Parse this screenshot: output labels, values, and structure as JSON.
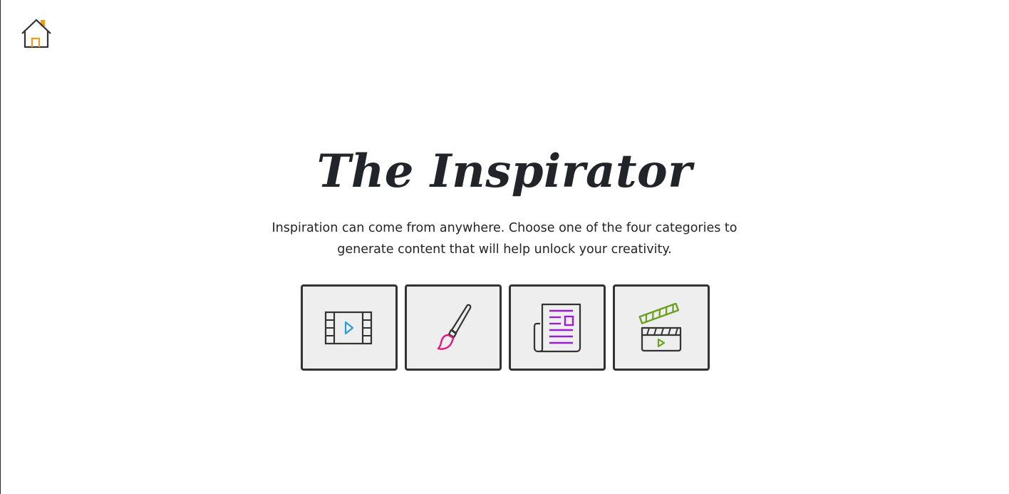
{
  "header": {
    "home_icon": "home-icon",
    "home_accent_color": "#f39c12",
    "home_stroke_color": "#333333"
  },
  "hero": {
    "title": "The Inspirator",
    "subtitle": "Inspiration can come from anywhere. Choose one of the four categories to generate content that will help unlock your creativity."
  },
  "categories": [
    {
      "icon": "film-strip-icon",
      "accent_color": "#2e9bd6"
    },
    {
      "icon": "paintbrush-icon",
      "accent_color": "#e0187f"
    },
    {
      "icon": "newspaper-icon",
      "accent_color": "#9b1fc9"
    },
    {
      "icon": "clapperboard-icon",
      "accent_color": "#6aa121"
    }
  ]
}
